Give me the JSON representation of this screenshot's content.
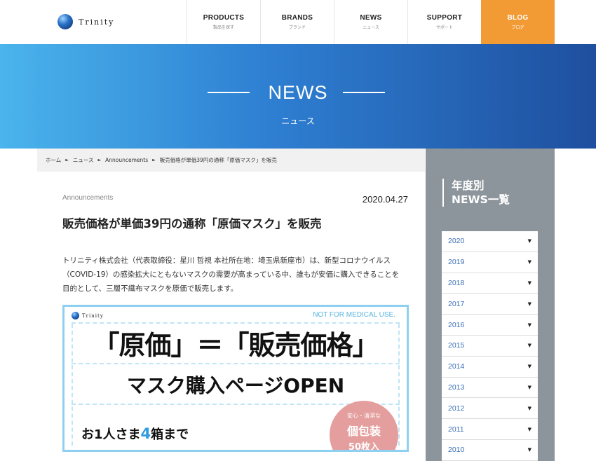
{
  "header": {
    "logo_text": "Trinity",
    "nav": [
      {
        "en": "PRODUCTS",
        "jp": "製品を探す"
      },
      {
        "en": "BRANDS",
        "jp": "ブランド"
      },
      {
        "en": "NEWS",
        "jp": "ニュース"
      },
      {
        "en": "SUPPORT",
        "jp": "サポート"
      },
      {
        "en": "BLOG",
        "jp": "ブログ"
      }
    ],
    "colors": {
      "blog": "#f29a33"
    }
  },
  "hero": {
    "title": "NEWS",
    "subtitle": "ニュース"
  },
  "breadcrumb": [
    "ホーム",
    "ニュース",
    "Announcements",
    "販売価格が単価39円の通称「原価マスク」を販売"
  ],
  "article": {
    "category": "Announcements",
    "date": "2020.04.27",
    "title": "販売価格が単価39円の通称「原価マスク」を販売",
    "body_lines": [
      "トリニティ株式会社（代表取締役：星川 哲視 本社所在地：埼玉県新座市）は、新型コロナウイルス",
      "（COVID-19）の感染拡大にともないマスクの需要が高まっている中、誰もが安価に購入できることを",
      "目的として、三層不織布マスクを原価で販売します。"
    ]
  },
  "banner": {
    "logo_text": "Trinity",
    "note": "NOT FOR MEDICAL USE.",
    "line1": "「原価」＝「販売価格」",
    "line2": "マスク購入ページOPEN",
    "line3_pre": "お1人さま",
    "line3_num": "4",
    "line3_post": "箱まで",
    "badge_small": "安心・清潔な",
    "badge_main": "個包装",
    "badge_count": "50枚入"
  },
  "sidebar": {
    "title_line1": "年度別",
    "title_line2": "NEWS一覧",
    "years": [
      "2020",
      "2019",
      "2018",
      "2017",
      "2016",
      "2015",
      "2014",
      "2013",
      "2012",
      "2011",
      "2010"
    ]
  }
}
